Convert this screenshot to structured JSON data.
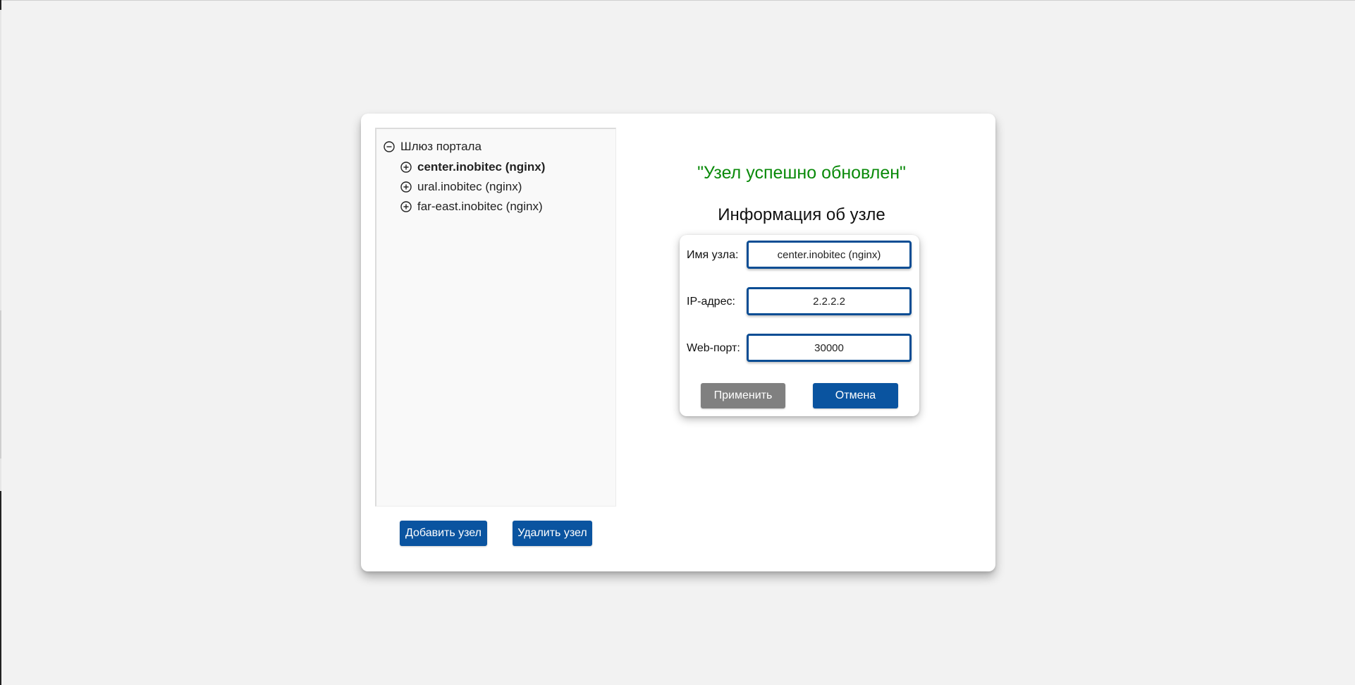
{
  "tree": {
    "root_label": "Шлюз портала",
    "nodes": [
      {
        "label": "center.inobitec (nginx)",
        "selected": true
      },
      {
        "label": "ural.inobitec (nginx)",
        "selected": false
      },
      {
        "label": "far-east.inobitec (nginx)",
        "selected": false
      }
    ]
  },
  "tree_actions": {
    "add_label": "Добавить узел",
    "delete_label": "Удалить узел"
  },
  "status": {
    "message": "\"Узел успешно обновлен\"",
    "color": "#0a8a0a"
  },
  "node_info": {
    "title": "Информация об узле",
    "name_label": "Имя узла:",
    "name_value": "center.inobitec (nginx)",
    "ip_label": "IP-адрес:",
    "ip_value": "2.2.2.2",
    "port_label": "Web-порт:",
    "port_value": "30000",
    "apply_label": "Применить",
    "cancel_label": "Отмена"
  },
  "colors": {
    "accent": "#0a54a0",
    "disabled": "#808080",
    "background": "#f2f2f2"
  }
}
